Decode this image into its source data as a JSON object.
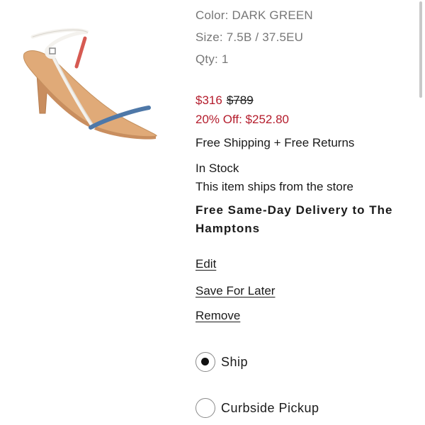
{
  "item": {
    "color": "Color: DARK GREEN",
    "size": "Size: 7.5B / 37.5EU",
    "qty": "Qty: 1"
  },
  "pricing": {
    "sale_price": "$316",
    "original_price": "$789",
    "discount": "20% Off: $252.80"
  },
  "shipping": {
    "returns": "Free Shipping + Free Returns",
    "stock": "In Stock",
    "ships_from": "This item ships from the store",
    "same_day": "Free Same-Day Delivery to The Hamptons"
  },
  "actions": {
    "edit": "Edit",
    "save_for_later": "Save For Later",
    "remove": "Remove"
  },
  "fulfillment": {
    "selected": "Ship",
    "options": [
      {
        "label": "Ship",
        "selected": true
      },
      {
        "label": "Curbside Pickup",
        "selected": false
      }
    ]
  },
  "colors": {
    "sale_red": "#b41c2c",
    "muted_gray": "#777777",
    "text": "#1a1a1a"
  }
}
